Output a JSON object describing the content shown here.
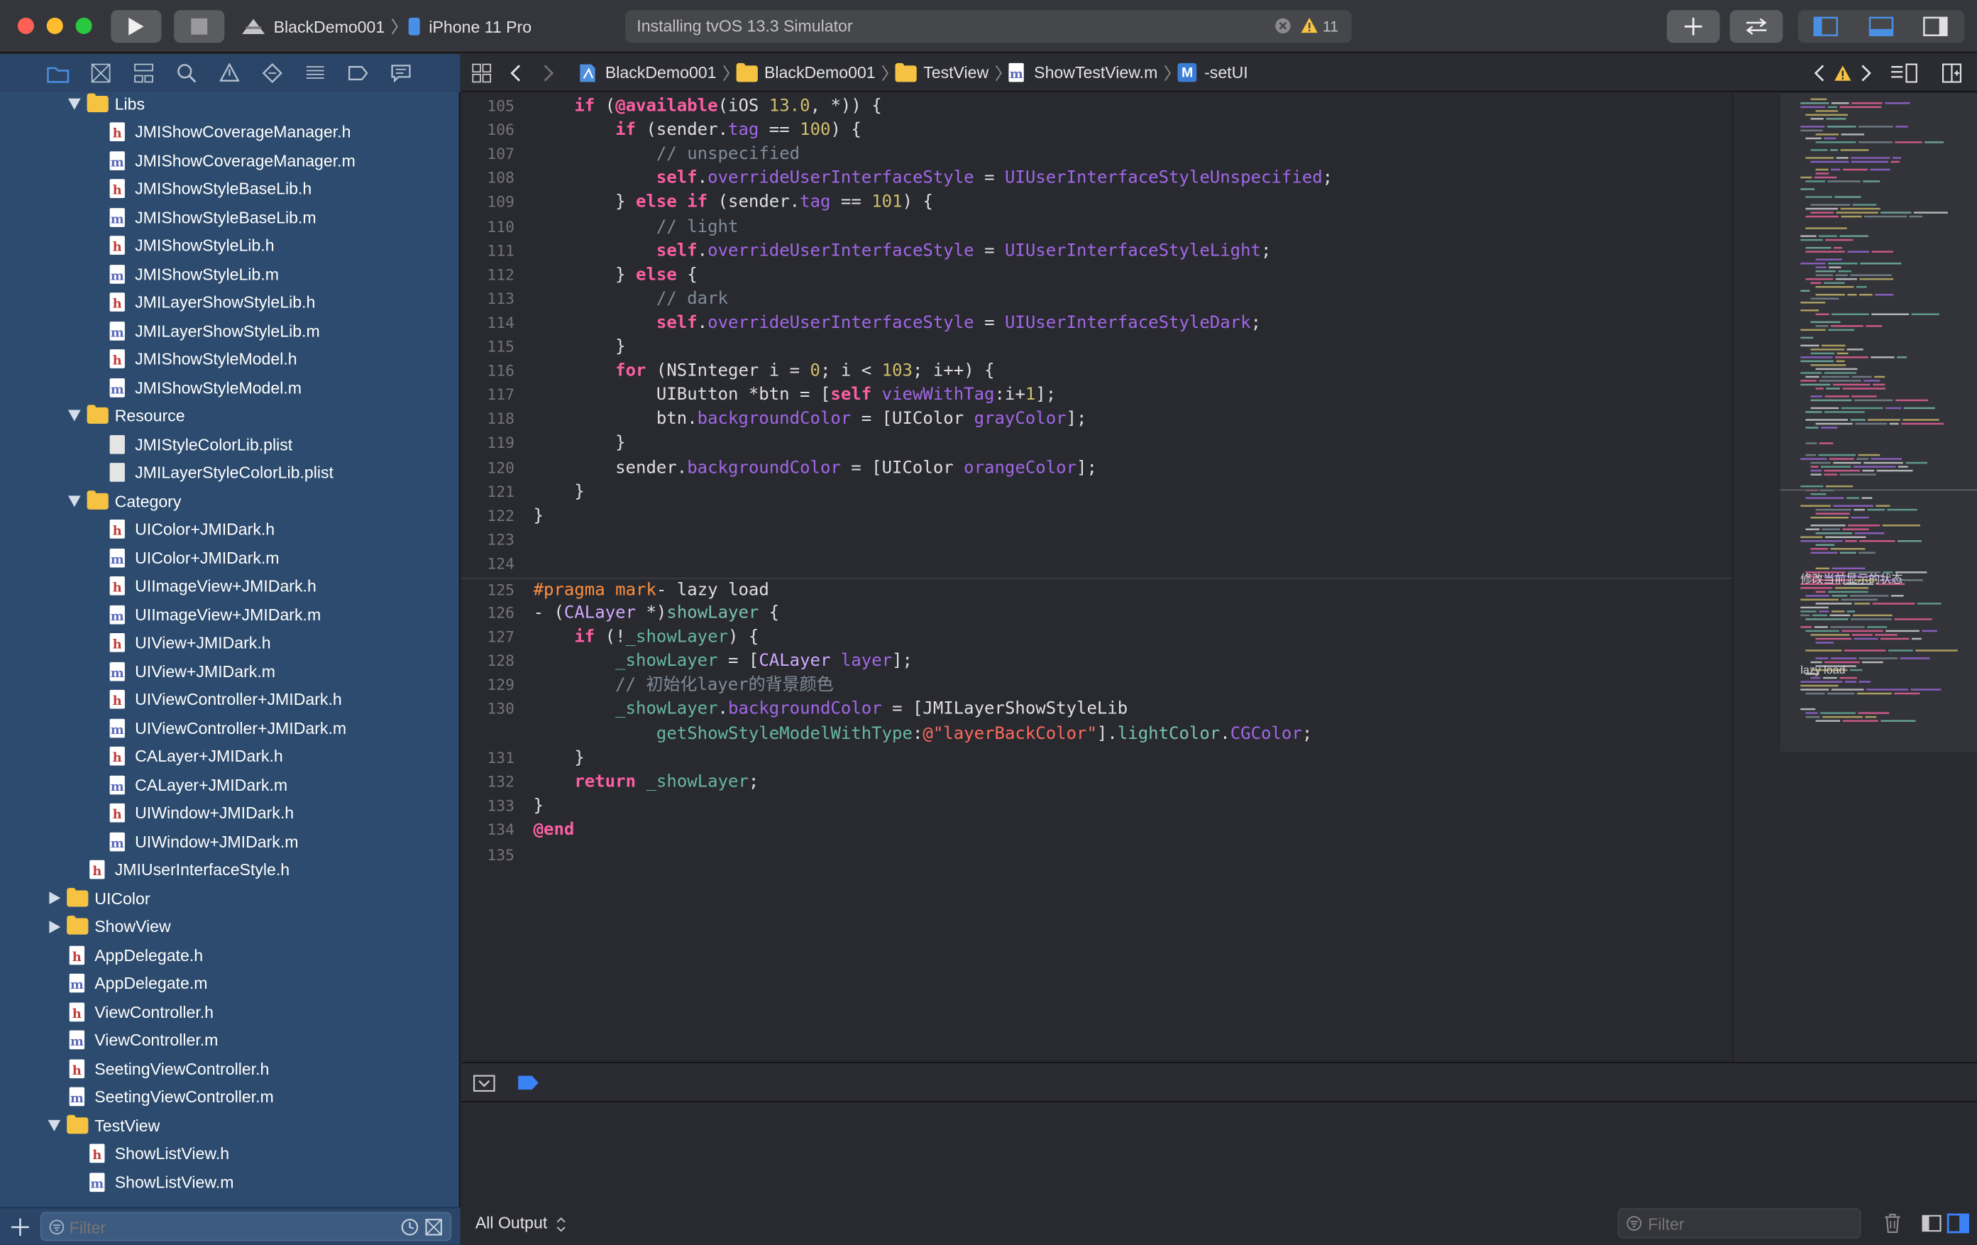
{
  "toolbar": {
    "scheme": "BlackDemo001",
    "device": "iPhone 11 Pro",
    "activity_text": "Installing tvOS 13.3 Simulator",
    "warning_count": "11"
  },
  "navigator": {
    "filter_placeholder": "Filter",
    "items": [
      {
        "label": "Libs",
        "type": "folder",
        "indent": 1,
        "expanded": true
      },
      {
        "label": "JMIShowCoverageManager.h",
        "type": "h",
        "indent": 2
      },
      {
        "label": "JMIShowCoverageManager.m",
        "type": "m",
        "indent": 2
      },
      {
        "label": "JMIShowStyleBaseLib.h",
        "type": "h",
        "indent": 2
      },
      {
        "label": "JMIShowStyleBaseLib.m",
        "type": "m",
        "indent": 2
      },
      {
        "label": "JMIShowStyleLib.h",
        "type": "h",
        "indent": 2
      },
      {
        "label": "JMIShowStyleLib.m",
        "type": "m",
        "indent": 2
      },
      {
        "label": "JMILayerShowStyleLib.h",
        "type": "h",
        "indent": 2
      },
      {
        "label": "JMILayerShowStyleLib.m",
        "type": "m",
        "indent": 2
      },
      {
        "label": "JMIShowStyleModel.h",
        "type": "h",
        "indent": 2
      },
      {
        "label": "JMIShowStyleModel.m",
        "type": "m",
        "indent": 2
      },
      {
        "label": "Resource",
        "type": "folder",
        "indent": 1,
        "expanded": true
      },
      {
        "label": "JMIStyleColorLib.plist",
        "type": "p",
        "indent": 2
      },
      {
        "label": "JMILayerStyleColorLib.plist",
        "type": "p",
        "indent": 2
      },
      {
        "label": "Category",
        "type": "folder",
        "indent": 1,
        "expanded": true
      },
      {
        "label": "UIColor+JMIDark.h",
        "type": "h",
        "indent": 2
      },
      {
        "label": "UIColor+JMIDark.m",
        "type": "m",
        "indent": 2
      },
      {
        "label": "UIImageView+JMIDark.h",
        "type": "h",
        "indent": 2
      },
      {
        "label": "UIImageView+JMIDark.m",
        "type": "m",
        "indent": 2
      },
      {
        "label": "UIView+JMIDark.h",
        "type": "h",
        "indent": 2
      },
      {
        "label": "UIView+JMIDark.m",
        "type": "m",
        "indent": 2
      },
      {
        "label": "UIViewController+JMIDark.h",
        "type": "h",
        "indent": 2
      },
      {
        "label": "UIViewController+JMIDark.m",
        "type": "m",
        "indent": 2
      },
      {
        "label": "CALayer+JMIDark.h",
        "type": "h",
        "indent": 2
      },
      {
        "label": "CALayer+JMIDark.m",
        "type": "m",
        "indent": 2
      },
      {
        "label": "UIWindow+JMIDark.h",
        "type": "h",
        "indent": 2
      },
      {
        "label": "UIWindow+JMIDark.m",
        "type": "m",
        "indent": 2
      },
      {
        "label": "JMIUserInterfaceStyle.h",
        "type": "h",
        "indent": 1
      },
      {
        "label": "UIColor",
        "type": "folder",
        "indent": 0,
        "expanded": false
      },
      {
        "label": "ShowView",
        "type": "folder",
        "indent": 0,
        "expanded": false
      },
      {
        "label": "AppDelegate.h",
        "type": "h",
        "indent": 0
      },
      {
        "label": "AppDelegate.m",
        "type": "m",
        "indent": 0
      },
      {
        "label": "ViewController.h",
        "type": "h",
        "indent": 0
      },
      {
        "label": "ViewController.m",
        "type": "m",
        "indent": 0
      },
      {
        "label": "SeetingViewController.h",
        "type": "h",
        "indent": 0
      },
      {
        "label": "SeetingViewController.m",
        "type": "m",
        "indent": 0
      },
      {
        "label": "TestView",
        "type": "folder",
        "indent": 0,
        "expanded": true
      },
      {
        "label": "ShowListView.h",
        "type": "h",
        "indent": 1
      },
      {
        "label": "ShowListView.m",
        "type": "m",
        "indent": 1
      }
    ]
  },
  "jumpbar": {
    "crumbs": [
      "BlackDemo001",
      "BlackDemo001",
      "TestView",
      "ShowTestView.m"
    ],
    "method_badge": "M",
    "method": "-setUI"
  },
  "editor": {
    "lines": [
      {
        "n": "105",
        "t": [
          [
            "    ",
            ""
          ],
          [
            "if",
            "kw"
          ],
          [
            " (",
            ""
          ],
          [
            "@available",
            "kw"
          ],
          [
            "(iOS ",
            ""
          ],
          [
            "13.0",
            "num"
          ],
          [
            ", *)) {",
            ""
          ]
        ]
      },
      {
        "n": "106",
        "t": [
          [
            "        ",
            ""
          ],
          [
            "if",
            "kw"
          ],
          [
            " (sender.",
            ""
          ],
          [
            "tag",
            "prop"
          ],
          [
            " == ",
            ""
          ],
          [
            "100",
            "num"
          ],
          [
            ") {",
            ""
          ]
        ]
      },
      {
        "n": "107",
        "t": [
          [
            "            ",
            ""
          ],
          [
            "// unspecified",
            "cm"
          ]
        ]
      },
      {
        "n": "108",
        "t": [
          [
            "            ",
            ""
          ],
          [
            "self",
            "kw"
          ],
          [
            ".",
            ""
          ],
          [
            "overrideUserInterfaceStyle",
            "prop"
          ],
          [
            " = ",
            ""
          ],
          [
            "UIUserInterfaceStyleUnspecified",
            "prop"
          ],
          [
            ";",
            ""
          ]
        ]
      },
      {
        "n": "109",
        "t": [
          [
            "        } ",
            ""
          ],
          [
            "else",
            "kw"
          ],
          [
            " ",
            ""
          ],
          [
            "if",
            "kw"
          ],
          [
            " (sender.",
            ""
          ],
          [
            "tag",
            "prop"
          ],
          [
            " == ",
            ""
          ],
          [
            "101",
            "num"
          ],
          [
            ") {",
            ""
          ]
        ]
      },
      {
        "n": "110",
        "t": [
          [
            "            ",
            ""
          ],
          [
            "// light",
            "cm"
          ]
        ]
      },
      {
        "n": "111",
        "t": [
          [
            "            ",
            ""
          ],
          [
            "self",
            "kw"
          ],
          [
            ".",
            ""
          ],
          [
            "overrideUserInterfaceStyle",
            "prop"
          ],
          [
            " = ",
            ""
          ],
          [
            "UIUserInterfaceStyleLight",
            "prop"
          ],
          [
            ";",
            ""
          ]
        ]
      },
      {
        "n": "112",
        "t": [
          [
            "        } ",
            ""
          ],
          [
            "else",
            "kw"
          ],
          [
            " {",
            ""
          ]
        ]
      },
      {
        "n": "113",
        "t": [
          [
            "            ",
            ""
          ],
          [
            "// dark",
            "cm"
          ]
        ]
      },
      {
        "n": "114",
        "t": [
          [
            "            ",
            ""
          ],
          [
            "self",
            "kw"
          ],
          [
            ".",
            ""
          ],
          [
            "overrideUserInterfaceStyle",
            "prop"
          ],
          [
            " = ",
            ""
          ],
          [
            "UIUserInterfaceStyleDark",
            "prop"
          ],
          [
            ";",
            ""
          ]
        ]
      },
      {
        "n": "115",
        "t": [
          [
            "        }",
            ""
          ]
        ]
      },
      {
        "n": "116",
        "t": [
          [
            "        ",
            ""
          ],
          [
            "for",
            "kw"
          ],
          [
            " (NSInteger i = ",
            ""
          ],
          [
            "0",
            "num"
          ],
          [
            "; i < ",
            ""
          ],
          [
            "103",
            "num"
          ],
          [
            "; i++) {",
            ""
          ]
        ]
      },
      {
        "n": "117",
        "t": [
          [
            "            UIButton *btn = [",
            ""
          ],
          [
            "self",
            "kw"
          ],
          [
            " ",
            ""
          ],
          [
            "viewWithTag",
            "prop"
          ],
          [
            ":i+",
            ""
          ],
          [
            "1",
            "num"
          ],
          [
            "];",
            ""
          ]
        ]
      },
      {
        "n": "118",
        "t": [
          [
            "            btn.",
            ""
          ],
          [
            "backgroundColor",
            "prop"
          ],
          [
            " = [UIColor ",
            ""
          ],
          [
            "grayColor",
            "prop"
          ],
          [
            "];",
            ""
          ]
        ]
      },
      {
        "n": "119",
        "t": [
          [
            "        }",
            ""
          ]
        ]
      },
      {
        "n": "120",
        "t": [
          [
            "        sender.",
            ""
          ],
          [
            "backgroundColor",
            "prop"
          ],
          [
            " = [UIColor ",
            ""
          ],
          [
            "orangeColor",
            "prop"
          ],
          [
            "];",
            ""
          ]
        ]
      },
      {
        "n": "121",
        "t": [
          [
            "    }",
            ""
          ]
        ]
      },
      {
        "n": "122",
        "t": [
          [
            "}",
            ""
          ]
        ]
      },
      {
        "n": "123",
        "t": []
      },
      {
        "n": "124",
        "t": []
      },
      {
        "n": "125",
        "t": [
          [
            "#pragma",
            "prep"
          ],
          [
            " ",
            ""
          ],
          [
            "mark",
            "prep"
          ],
          [
            "- lazy load",
            ""
          ]
        ]
      },
      {
        "n": "126",
        "t": [
          [
            "- (",
            ""
          ],
          [
            "CALayer",
            "cls"
          ],
          [
            " *)",
            ""
          ],
          [
            "showLayer",
            "mth"
          ],
          [
            " {",
            ""
          ]
        ]
      },
      {
        "n": "127",
        "t": [
          [
            "    ",
            ""
          ],
          [
            "if",
            "kw"
          ],
          [
            " (!",
            ""
          ],
          [
            "_showLayer",
            "var"
          ],
          [
            ") {",
            ""
          ]
        ]
      },
      {
        "n": "128",
        "t": [
          [
            "        ",
            ""
          ],
          [
            "_showLayer",
            "var"
          ],
          [
            " = [",
            ""
          ],
          [
            "CALayer",
            "cls"
          ],
          [
            " ",
            ""
          ],
          [
            "layer",
            "prop"
          ],
          [
            "];",
            ""
          ]
        ]
      },
      {
        "n": "129",
        "t": [
          [
            "        ",
            ""
          ],
          [
            "// 初始化layer的背景颜色",
            "cm"
          ]
        ]
      },
      {
        "n": "130",
        "t": [
          [
            "        ",
            ""
          ],
          [
            "_showLayer",
            "var"
          ],
          [
            ".",
            ""
          ],
          [
            "backgroundColor",
            "prop"
          ],
          [
            " = [JMILayerShowStyleLib",
            ""
          ]
        ]
      },
      {
        "n": "",
        "t": [
          [
            "            ",
            ""
          ],
          [
            "getShowStyleModelWithType",
            "var"
          ],
          [
            ":",
            ""
          ],
          [
            "@\"layerBackColor\"",
            "str"
          ],
          [
            "].",
            ""
          ],
          [
            "lightColor",
            "mth"
          ],
          [
            ".",
            ""
          ],
          [
            "CGColor",
            "prop"
          ],
          [
            ";",
            ""
          ]
        ]
      },
      {
        "n": "131",
        "t": [
          [
            "    }",
            ""
          ]
        ]
      },
      {
        "n": "132",
        "t": [
          [
            "    ",
            ""
          ],
          [
            "return",
            "kw"
          ],
          [
            " ",
            ""
          ],
          [
            "_showLayer",
            "var"
          ],
          [
            ";",
            ""
          ]
        ]
      },
      {
        "n": "133",
        "t": [
          [
            "}",
            ""
          ]
        ]
      },
      {
        "n": "134",
        "t": [
          [
            "@end",
            "kw"
          ]
        ]
      },
      {
        "n": "135",
        "t": []
      }
    ]
  },
  "minimap": {
    "marks": [
      "修改当前显示的状态",
      "lazy load"
    ]
  },
  "console": {
    "output_selector": "All Output",
    "filter_placeholder": "Filter"
  },
  "colors": {
    "navigator_bg": "#2c4b6e",
    "editor_bg": "#292a30",
    "keyword": "#fc5fa3",
    "number": "#d0bf69",
    "comment": "#7f8c98",
    "string": "#fc6a5d",
    "property": "#a167e6",
    "accent": "#3b82f6",
    "warning": "#f5c242"
  }
}
